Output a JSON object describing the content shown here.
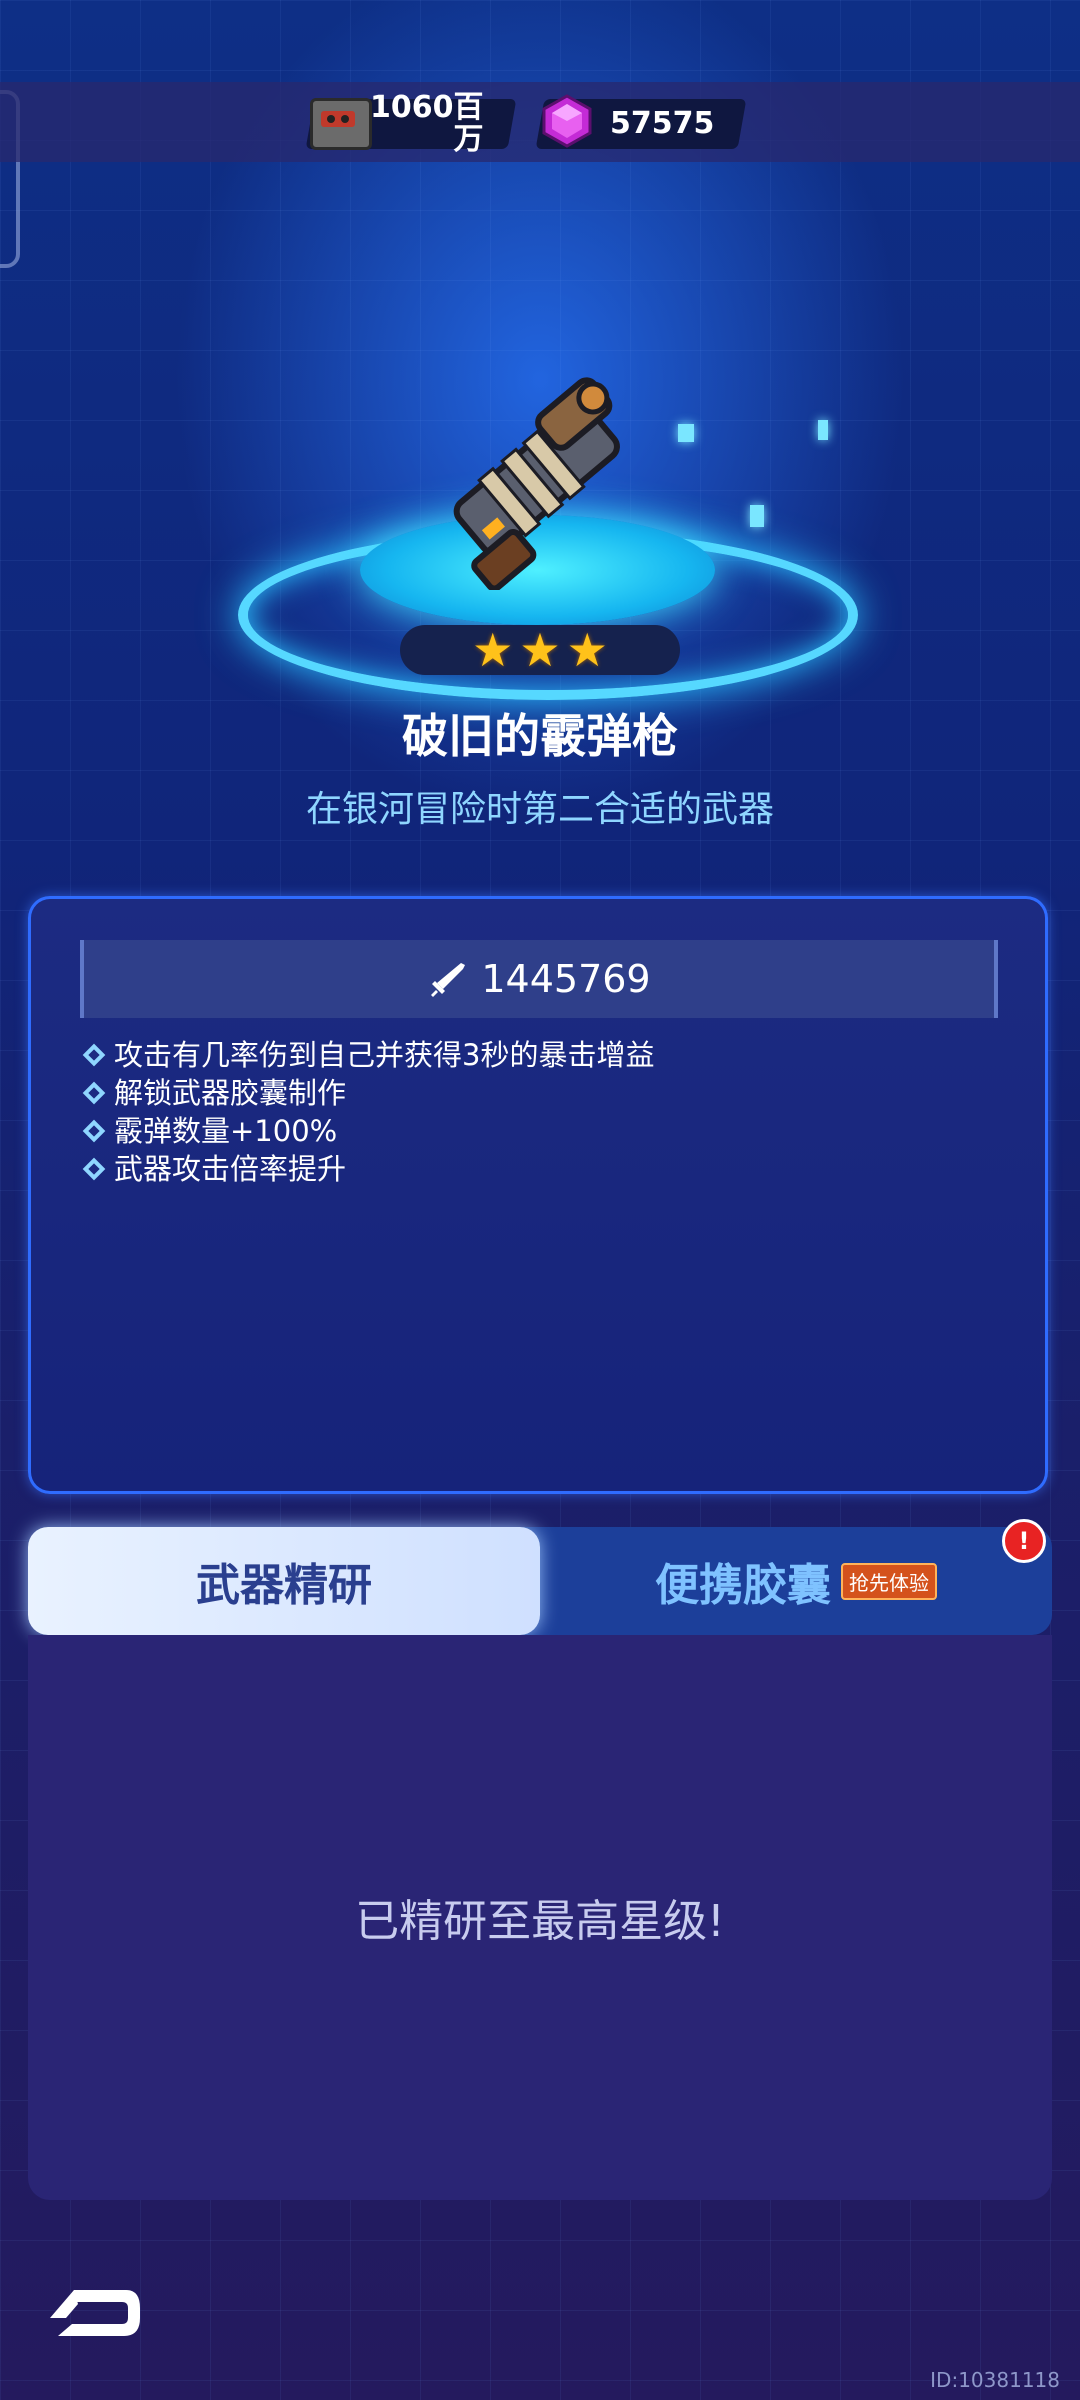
{
  "resources": {
    "tape": {
      "icon": "cassette-tape-icon",
      "value": "1060百\n万"
    },
    "gem": {
      "icon": "purple-gem-icon",
      "value": "57575"
    }
  },
  "weapon": {
    "icon": "shotgun-icon",
    "stars": 3,
    "name": "破旧的霰弹枪",
    "description": "在银河冒险时第二合适的武器"
  },
  "stats": {
    "power_icon": "sword-icon",
    "power": "1445769",
    "effects": [
      "攻击有几率伤到自己并获得3秒的暴击增益",
      "解锁武器胶囊制作",
      "霰弹数量+100%",
      "武器攻击倍率提升"
    ]
  },
  "tabs": {
    "active": "武器精研",
    "inactive": "便携胶囊",
    "inactive_badge": "抢先体验",
    "alert_icon": "exclamation-icon",
    "alert": "!"
  },
  "content": {
    "message": "已精研至最高星级!"
  },
  "footer": {
    "back_icon": "back-arrow-icon",
    "id": "ID:10381118"
  },
  "colors": {
    "accent": "#56d8ff",
    "star": "#ffc21a",
    "badge": "#d4521c",
    "alert": "#e82323"
  }
}
